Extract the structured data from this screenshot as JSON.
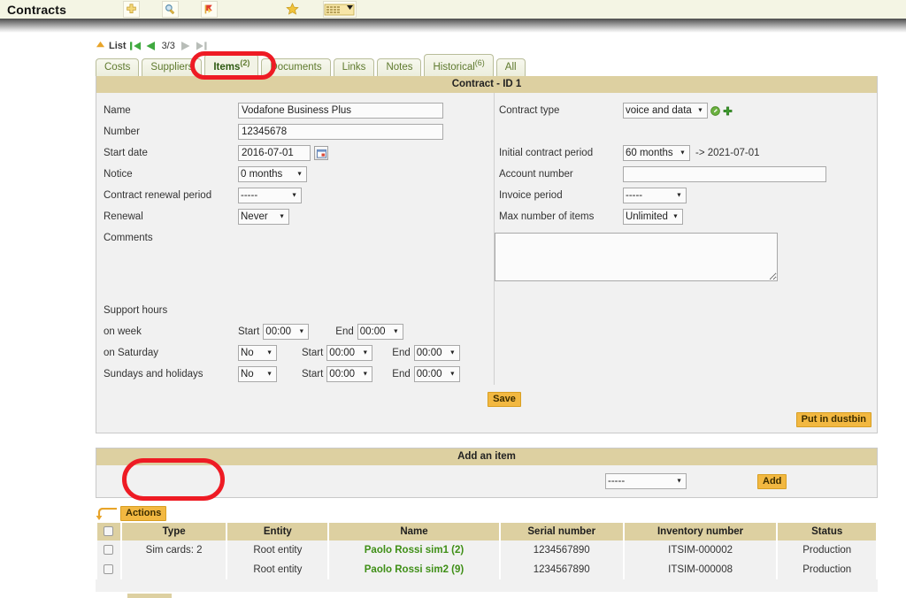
{
  "app": {
    "title": "Contracts",
    "header_icons": [
      {
        "name": "add-icon",
        "glyph": "plus-cross"
      },
      {
        "name": "search-icon",
        "glyph": "magnifier"
      },
      {
        "name": "bookmark-icon",
        "glyph": "red-flag"
      },
      {
        "name": "favorite-star-icon",
        "glyph": "star"
      },
      {
        "name": "list-view-icon",
        "glyph": "grid-dropdown"
      }
    ]
  },
  "nav": {
    "up_icon": "up-chevron-icon",
    "list_label": "List",
    "first_icon": "first-page-icon",
    "prev_icon": "previous-page-icon",
    "counter": "3/3",
    "next_icon": "next-page-icon",
    "last_icon": "last-page-icon"
  },
  "tabs": [
    {
      "label": "Costs",
      "sup": "",
      "active": false
    },
    {
      "label": "Suppliers",
      "sup": "",
      "active": false
    },
    {
      "label": "Items",
      "sup": "(2)",
      "active": true
    },
    {
      "label": "Documents",
      "sup": "",
      "active": false
    },
    {
      "label": "Links",
      "sup": "",
      "active": false
    },
    {
      "label": "Notes",
      "sup": "",
      "active": false
    },
    {
      "label": "Historical",
      "sup": "(6)",
      "active": false
    },
    {
      "label": "All",
      "sup": "",
      "active": false
    }
  ],
  "contract": {
    "section_title": "Contract - ID 1",
    "left": {
      "name_label": "Name",
      "name_value": "Vodafone Business Plus",
      "number_label": "Number",
      "number_value": "12345678",
      "start_date_label": "Start date",
      "start_date_value": "2016-07-01",
      "notice_label": "Notice",
      "notice_value": "0 months",
      "renewal_period_label": "Contract renewal period",
      "renewal_period_value": "-----",
      "renewal_label": "Renewal",
      "renewal_value": "Never",
      "comments_label": "Comments",
      "comments_value": ""
    },
    "right": {
      "contract_type_label": "Contract type",
      "contract_type_value": "voice and data",
      "initial_period_label": "Initial contract period",
      "initial_period_value": "60 months",
      "initial_period_suffix": "-> 2021-07-01",
      "account_number_label": "Account number",
      "account_number_value": "",
      "invoice_period_label": "Invoice period",
      "invoice_period_value": "-----",
      "max_items_label": "Max number of items",
      "max_items_value": "Unlimited"
    },
    "support": {
      "title": "Support hours",
      "week_label": "on week",
      "week_start_label": "Start",
      "week_start_value": "00:00",
      "week_end_label": "End",
      "week_end_value": "00:00",
      "saturday_label": "on Saturday",
      "saturday_enabled": "No",
      "saturday_start_label": "Start",
      "saturday_start_value": "00:00",
      "saturday_end_label": "End",
      "saturday_end_value": "00:00",
      "sunday_label": "Sundays and holidays",
      "sunday_enabled": "No",
      "sunday_start_label": "Start",
      "sunday_start_value": "00:00",
      "sunday_end_label": "End",
      "sunday_end_value": "00:00"
    },
    "save_label": "Save",
    "dustbin_label": "Put in dustbin"
  },
  "add_item": {
    "section_title": "Add an item",
    "select_value": "-----",
    "add_label": "Add"
  },
  "items_table": {
    "actions_label": "Actions",
    "columns": [
      "",
      "Type",
      "Entity",
      "Name",
      "Serial number",
      "Inventory number",
      "Status"
    ],
    "rows": [
      {
        "type": "Sim cards: 2",
        "entity": "Root entity",
        "name": "Paolo Rossi sim1 (2)",
        "serial": "1234567890",
        "inventory": "ITSIM-000002",
        "status": "Production"
      },
      {
        "type": "",
        "entity": "Root entity",
        "name": "Paolo Rossi sim2 (9)",
        "serial": "1234567890",
        "inventory": "ITSIM-000008",
        "status": "Production"
      }
    ]
  },
  "colors": {
    "header_bg": "#f4f5e4",
    "section_bar": "#ddd0a1",
    "panel_bg": "#f1f1f1",
    "tab_text": "#5f7a2f",
    "link_green": "#3f8f17",
    "button_yellow": "#f2b841",
    "annotation_red": "#ee1b24"
  }
}
